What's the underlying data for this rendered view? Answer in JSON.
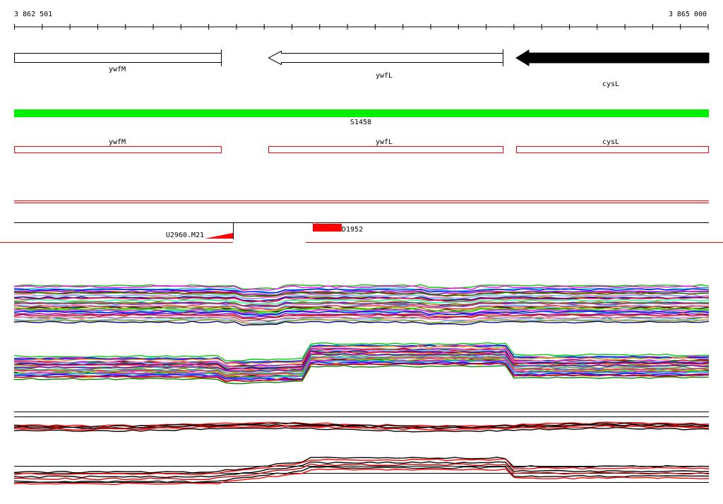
{
  "coordinates": {
    "start": "3 862 501",
    "end": "3 865 000"
  },
  "genes": [
    {
      "label": "ywfM",
      "strand": "+",
      "style": "outline"
    },
    {
      "label": "ywfL",
      "strand": "-",
      "style": "outline"
    },
    {
      "label": "cysL",
      "strand": "-",
      "style": "filled"
    }
  ],
  "segment": {
    "label": "S1458",
    "color": "#00ee00"
  },
  "gene_models": [
    {
      "label": "ywfM"
    },
    {
      "label": "ywfL"
    },
    {
      "label": "cysL"
    }
  ],
  "features": [
    {
      "label": "U2960.M21",
      "color": "#ff0000"
    },
    {
      "label": "D1952",
      "color": "#ff0000"
    }
  ],
  "colors": {
    "accent": "#ff0000",
    "track_line": "#000000"
  },
  "profile_tracks": [
    "expression-profiles-a",
    "expression-profiles-b",
    "expression-profiles-c",
    "expression-profiles-d"
  ]
}
